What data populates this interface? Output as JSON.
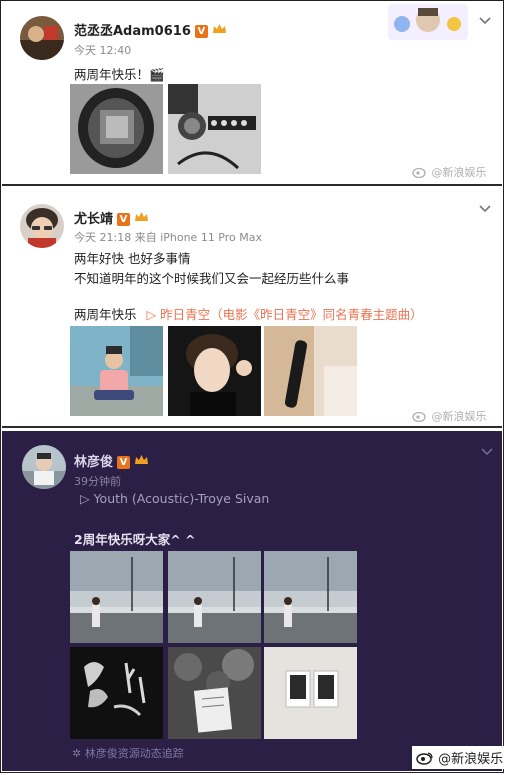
{
  "posts": [
    {
      "author": "范丞丞Adam0616",
      "verified_badge": "V",
      "time": "今天 12:40",
      "lines": [
        "两周年快乐！🎬"
      ],
      "watermark": "@新浪娱乐"
    },
    {
      "author": "尤长靖",
      "verified_badge": "V",
      "time": "今天 21:18 来自 iPhone 11 Pro Max",
      "lines": [
        "两年好快 也好多事情",
        "不知道明年的这个时候我们又会一起经历些什么事"
      ],
      "tag": "两周年快乐",
      "music_link": "▷ 昨日青空（电影《昨日青空》同名青春主题曲）",
      "watermark": "@新浪娱乐"
    },
    {
      "author": "林彦俊",
      "verified_badge": "V",
      "time": "39分钟前",
      "music_link": "▷ Youth (Acoustic)-Troye Sivan",
      "lines": [
        "2周年快乐呀大家^ ^"
      ],
      "footer": "林彦俊资源动态追踪"
    }
  ],
  "brand_watermark": "@新浪娱乐",
  "colors": {
    "accent": "#eb7350",
    "dark_bg": "#2b1f45",
    "badge": "#e8731a"
  }
}
